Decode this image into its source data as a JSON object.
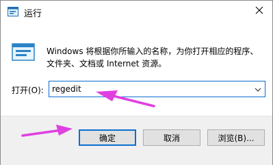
{
  "window": {
    "title": "运行"
  },
  "icons": {
    "title_icon": "run-dialog-icon",
    "main_icon": "run-program-icon",
    "close_icon": "close-icon",
    "dropdown_icon": "chevron-down-icon"
  },
  "description": {
    "line1": "Windows 将根据你所输入的名称，为你打开相应的程序、",
    "line2": "文件夹、文档或 Internet 资源。"
  },
  "open_field": {
    "label": "打开(O):",
    "value": "regedit"
  },
  "buttons": {
    "ok": "确定",
    "cancel": "取消",
    "browse": "浏览(B)..."
  },
  "annotations": {
    "arrow_color": "#e040e0"
  },
  "colors": {
    "accent": "#0a6ed1"
  }
}
